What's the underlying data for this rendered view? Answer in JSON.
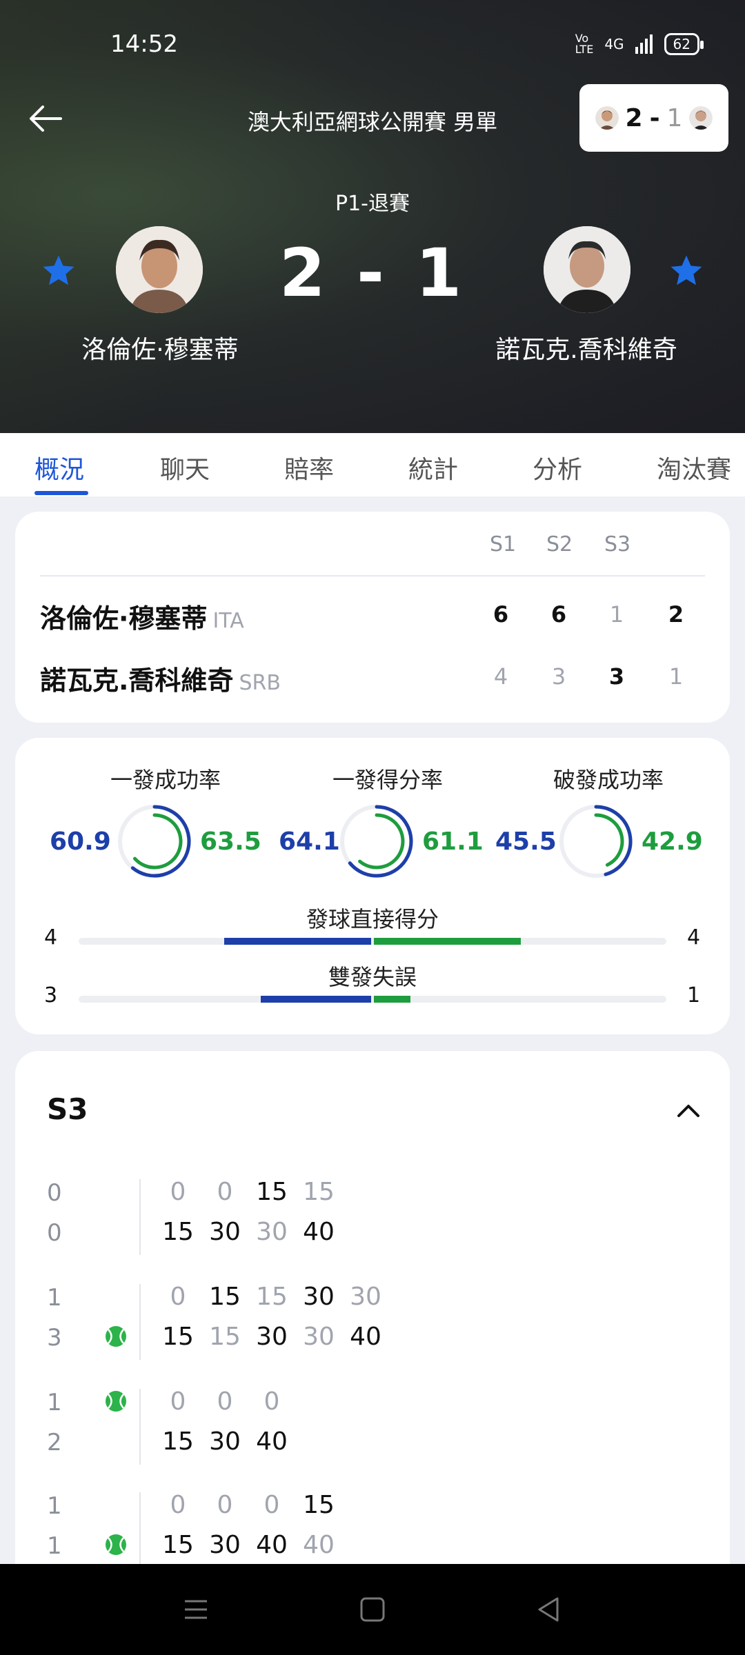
{
  "status_bar": {
    "time": "14:52",
    "network": "4G",
    "battery": "62"
  },
  "header": {
    "competition": "澳大利亞網球公開賽 男單",
    "match_status": "P1-退賽",
    "score": "2 - 1",
    "mini_score": {
      "home": "2",
      "sep": "-",
      "away": "1"
    },
    "home_player": {
      "name": "洛倫佐·穆塞蒂",
      "favorite": true
    },
    "away_player": {
      "name": "諾瓦克.喬科維奇",
      "favorite": true
    }
  },
  "tabs": [
    "概況",
    "聊天",
    "賠率",
    "統計",
    "分析",
    "淘汰賽"
  ],
  "active_tab": "概況",
  "sets": {
    "headers": [
      "S1",
      "S2",
      "S3"
    ],
    "rows": [
      {
        "name": "洛倫佐·穆塞蒂",
        "country": "ITA",
        "sets": [
          "6",
          "6",
          "1"
        ],
        "total": "2"
      },
      {
        "name": "諾瓦克.喬科維奇",
        "country": "SRB",
        "sets": [
          "4",
          "3",
          "3"
        ],
        "total": "1"
      }
    ]
  },
  "stats": {
    "rings": [
      {
        "label": "一發成功率",
        "left": "60.9",
        "right": "63.5",
        "left_pct": 0.609,
        "right_pct": 0.635
      },
      {
        "label": "一發得分率",
        "left": "64.1",
        "right": "61.1",
        "left_pct": 0.641,
        "right_pct": 0.611
      },
      {
        "label": "破發成功率",
        "left": "45.5",
        "right": "42.9",
        "left_pct": 0.455,
        "right_pct": 0.429
      }
    ],
    "bars": [
      {
        "label": "發球直接得分",
        "left": "4",
        "right": "4",
        "left_value": 4,
        "right_value": 4
      },
      {
        "label": "雙發失誤",
        "left": "3",
        "right": "1",
        "left_value": 3,
        "right_value": 1
      }
    ]
  },
  "pbp": {
    "title": "S3",
    "games": [
      {
        "home_games": "0",
        "away_games": "0",
        "home_points": [
          "0",
          "0",
          "15",
          "15"
        ],
        "away_points": [
          "15",
          "30",
          "30",
          "40"
        ],
        "home_dark": [
          false,
          false,
          true,
          false
        ],
        "away_dark": [
          true,
          true,
          false,
          true
        ],
        "server": "none"
      },
      {
        "home_games": "1",
        "away_games": "3",
        "home_points": [
          "0",
          "15",
          "15",
          "30",
          "30"
        ],
        "away_points": [
          "15",
          "15",
          "30",
          "30",
          "40"
        ],
        "home_dark": [
          false,
          true,
          false,
          true,
          false
        ],
        "away_dark": [
          true,
          false,
          true,
          false,
          true
        ],
        "server": "away"
      },
      {
        "home_games": "1",
        "away_games": "2",
        "home_points": [
          "0",
          "0",
          "0"
        ],
        "away_points": [
          "15",
          "30",
          "40"
        ],
        "home_dark": [
          false,
          false,
          false
        ],
        "away_dark": [
          true,
          true,
          true
        ],
        "server": "home"
      },
      {
        "home_games": "1",
        "away_games": "1",
        "home_points": [
          "0",
          "0",
          "0",
          "15"
        ],
        "away_points": [
          "15",
          "30",
          "40",
          "40"
        ],
        "home_dark": [
          false,
          false,
          false,
          true
        ],
        "away_dark": [
          true,
          true,
          true,
          false
        ],
        "server": "away"
      }
    ]
  },
  "colors": {
    "accent": "#1d56d9",
    "home": "#1d3fa9",
    "away": "#1e9d3e"
  },
  "icons": {
    "back": "back-arrow-icon",
    "star": "star-icon",
    "ball": "tennis-ball-icon",
    "collapse": "chevron-up-icon"
  }
}
